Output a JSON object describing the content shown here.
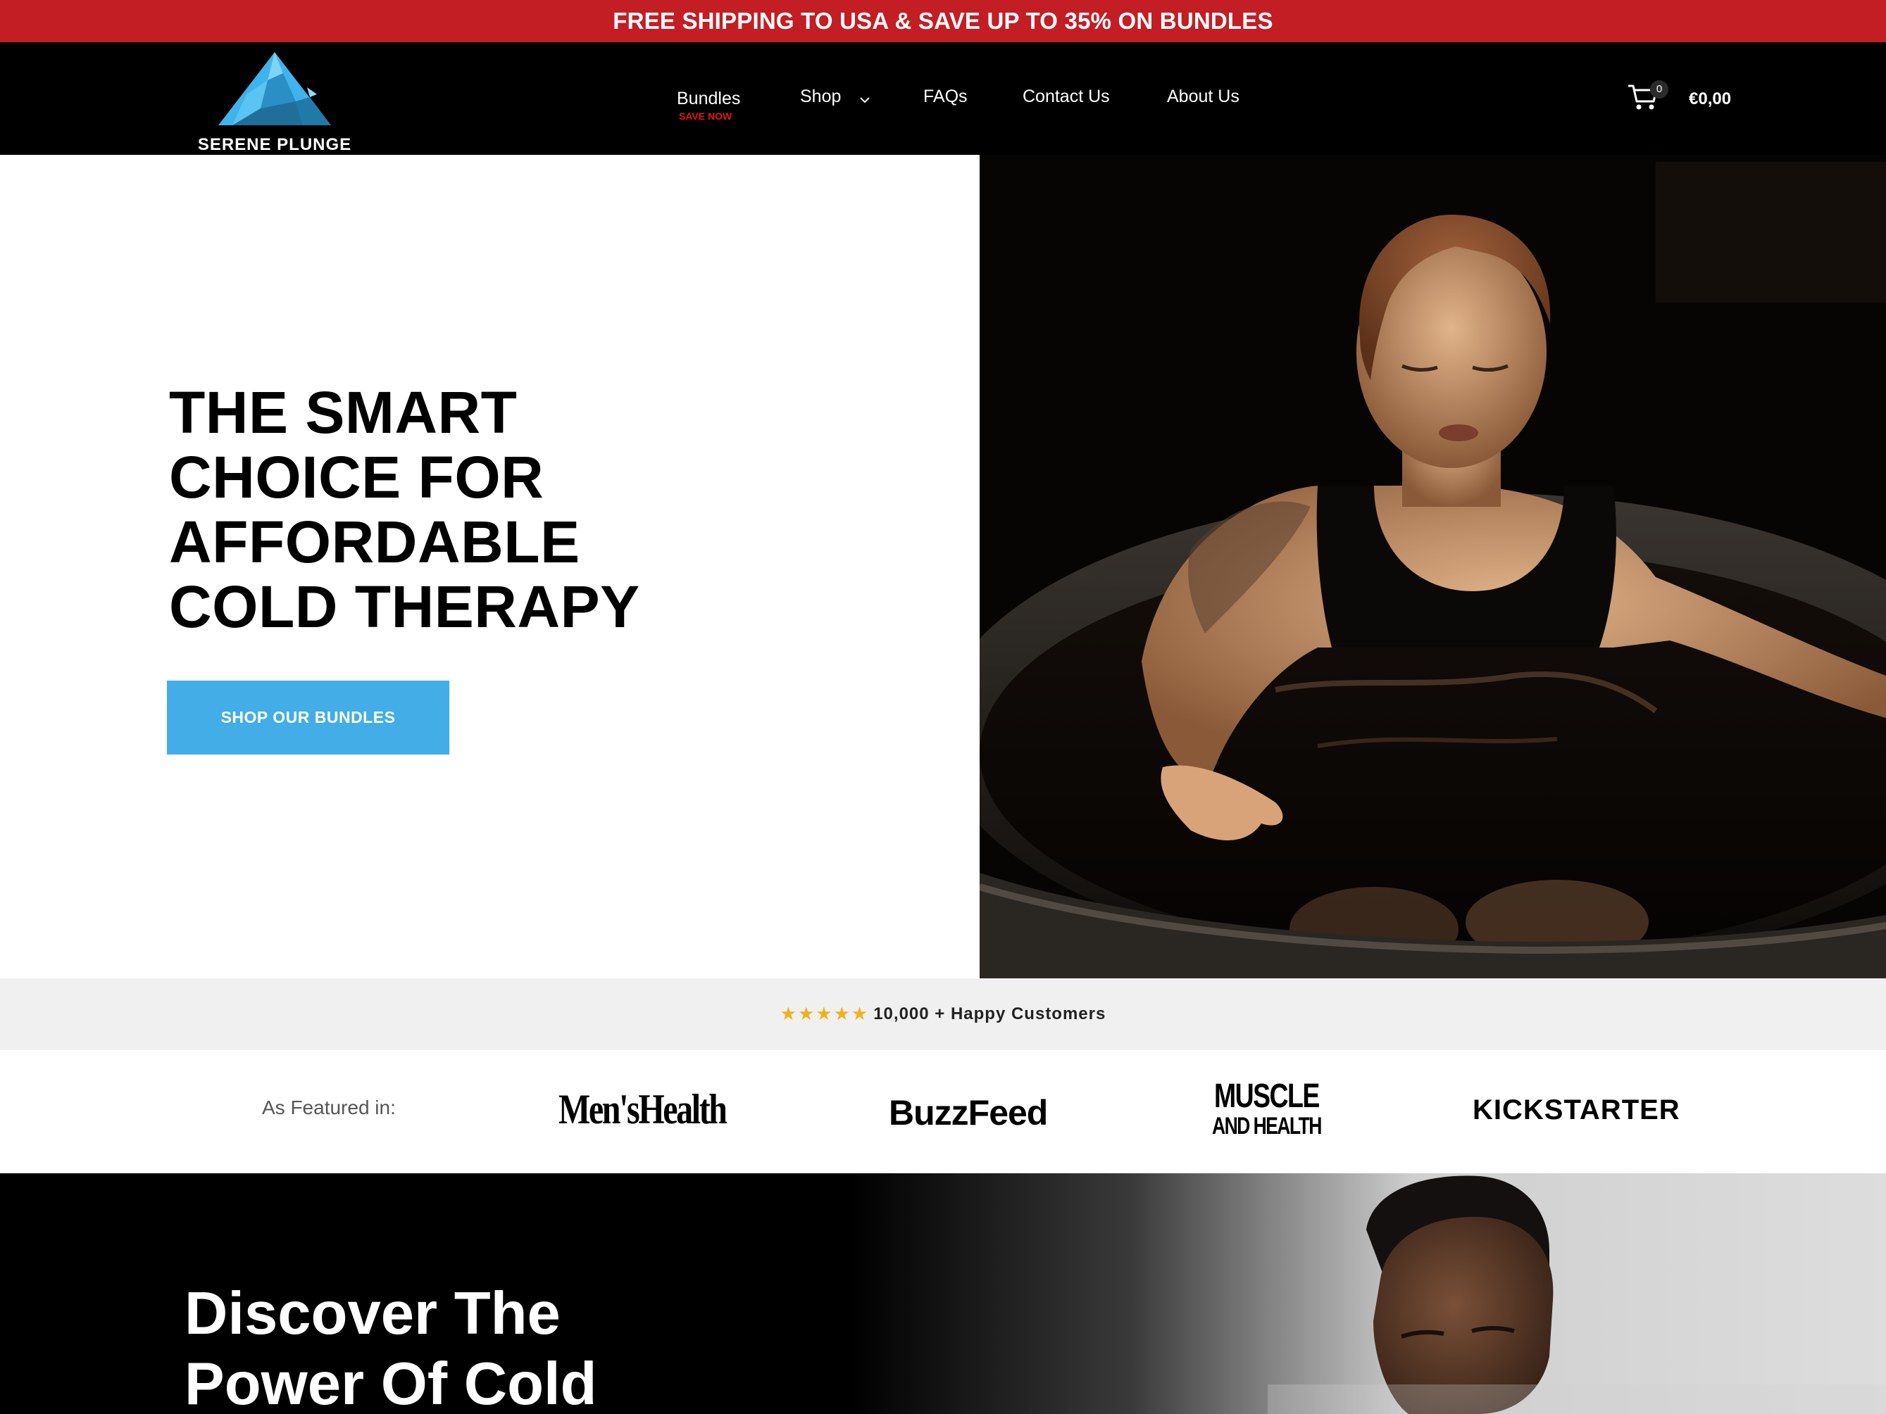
{
  "announcement": {
    "text": "FREE SHIPPING TO USA & SAVE UP TO 35% ON BUNDLES",
    "background": "#c21e24"
  },
  "header": {
    "brand_name": "SERENE PLUNGE",
    "nav": {
      "bundles": "Bundles",
      "bundles_badge": "SAVE NOW",
      "shop": "Shop",
      "faqs": "FAQs",
      "contact": "Contact Us",
      "about": "About Us"
    },
    "cart": {
      "count": "0",
      "total": "€0,00",
      "icon": "shopping-cart-icon"
    }
  },
  "hero": {
    "title_lines": [
      "THE SMART",
      "CHOICE FOR",
      "AFFORDABLE",
      "COLD THERAPY"
    ],
    "cta": "SHOP OUR BUNDLES",
    "accent_color": "#42ade6",
    "image": "woman-in-cold-plunge-tub-photo"
  },
  "reviews": {
    "rating_stars": 5,
    "text": "10,000 + Happy Customers",
    "star_color": "#f2b01e"
  },
  "featured": {
    "label": "As Featured in:",
    "brands": {
      "mens_health": "Men'sHealth",
      "buzzfeed": "BuzzFeed",
      "muscle_line1": "MUSCLE",
      "muscle_line2": "AND HEALTH",
      "kickstarter": "KICKSTARTER"
    }
  },
  "discover": {
    "title_lines": [
      "Discover The",
      "Power Of Cold"
    ],
    "image": "man-portrait-photo"
  }
}
